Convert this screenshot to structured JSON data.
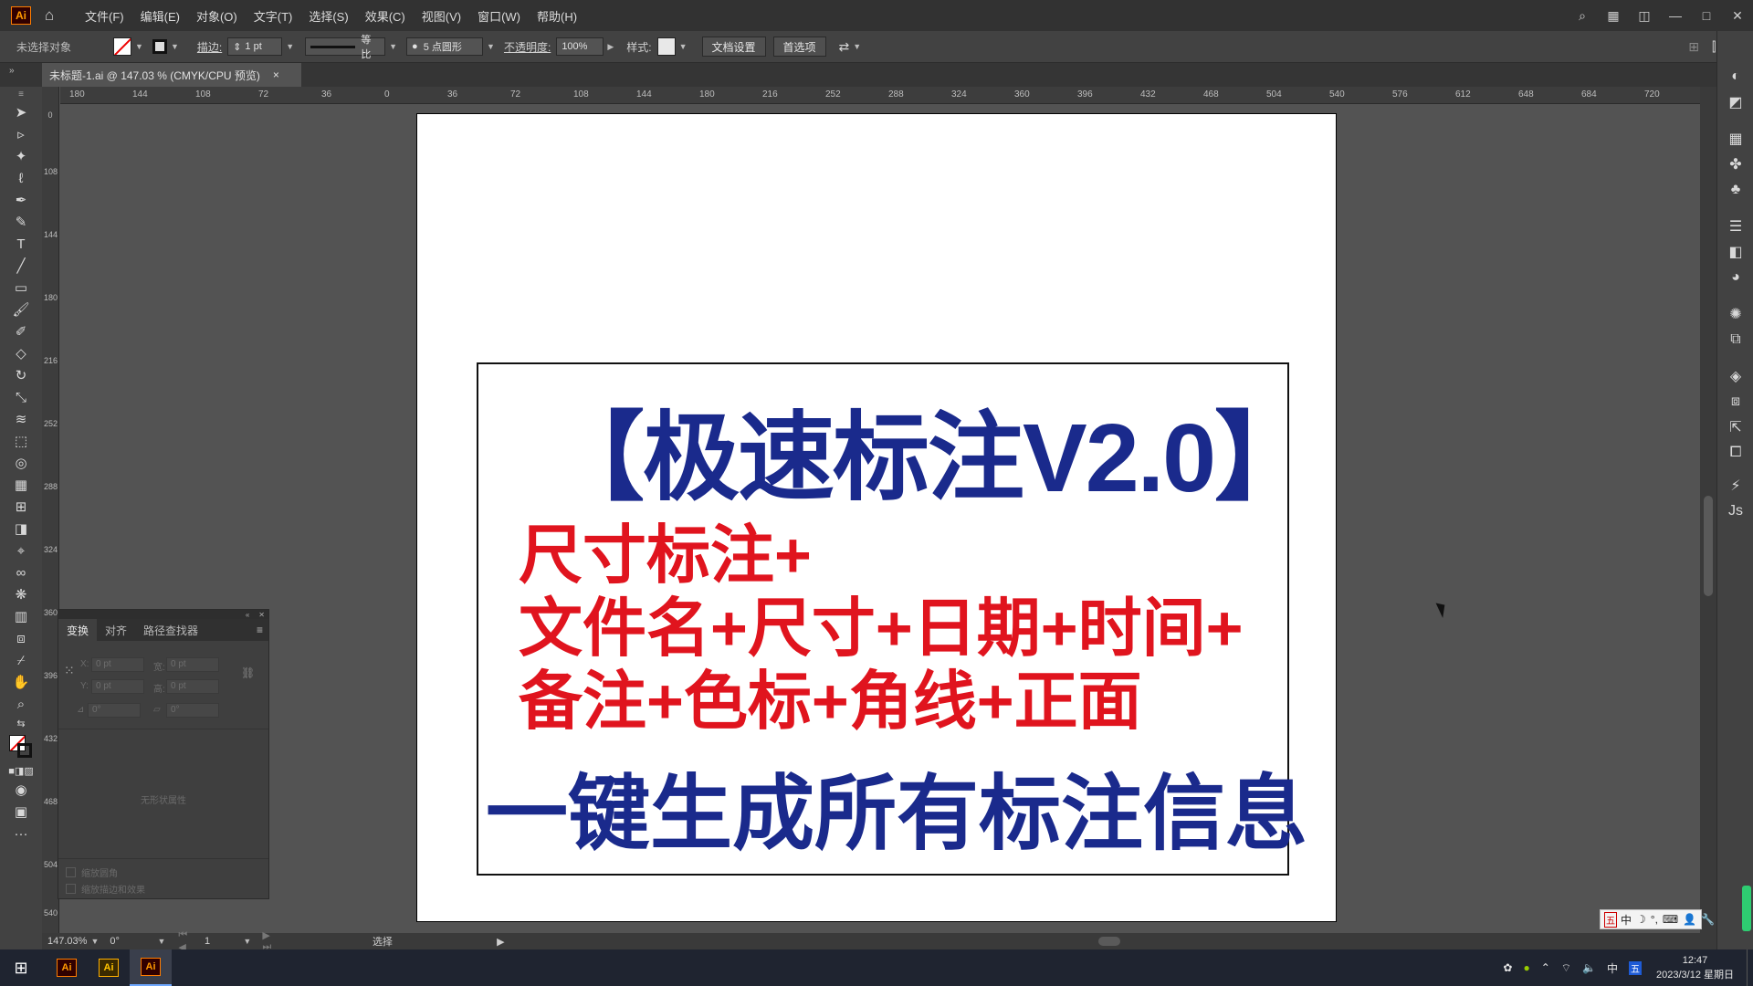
{
  "app": {
    "logo": "Ai",
    "menu": [
      "文件(F)",
      "编辑(E)",
      "对象(O)",
      "文字(T)",
      "选择(S)",
      "效果(C)",
      "视图(V)",
      "窗口(W)",
      "帮助(H)"
    ]
  },
  "control_bar": {
    "selection_status": "未选择对象",
    "stroke_label": "描边:",
    "stroke_value": "1 pt",
    "profile_label": "等比",
    "brush_label": "5 点圆形",
    "opacity_label": "不透明度:",
    "opacity_value": "100%",
    "style_label": "样式:",
    "doc_setup_button": "文档设置",
    "preferences_button": "首选项"
  },
  "document_tab": {
    "title": "未标题-1.ai @ 147.03 % (CMYK/CPU 预览)",
    "close": "×"
  },
  "ruler": {
    "h_ticks": [
      "180",
      "144",
      "108",
      "72",
      "36",
      "0",
      "36",
      "72",
      "108",
      "144",
      "180",
      "216",
      "252",
      "288",
      "324",
      "360",
      "396",
      "432",
      "468",
      "504",
      "540",
      "576",
      "612",
      "648",
      "684",
      "720"
    ],
    "v_ticks": [
      "0",
      "108",
      "144",
      "180",
      "216",
      "252",
      "288",
      "324",
      "360",
      "396",
      "432",
      "468",
      "504",
      "540"
    ]
  },
  "artboard": {
    "title": "【极速标注V2.0】",
    "lines": [
      "尺寸标注+",
      "文件名+尺寸+日期+时间+",
      "备注+色标+角线+正面"
    ],
    "subtitle": "一键生成所有标注信息"
  },
  "panel": {
    "tabs": [
      "变换",
      "对齐",
      "路径查找器"
    ],
    "x_label": "X:",
    "x_value": "0 pt",
    "y_label": "Y:",
    "y_value": "0 pt",
    "w_label": "宽:",
    "w_value": "0 pt",
    "h_label": "高:",
    "h_value": "0 pt",
    "angle_value": "0°",
    "shear_value": "0°",
    "empty_msg": "无形状属性",
    "opt1": "缩放圆角",
    "opt2": "缩放描边和效果"
  },
  "status_bar": {
    "zoom": "147.03%",
    "rotate": "0°",
    "page": "1",
    "tool": "选择"
  },
  "taskbar": {
    "time": "12:47",
    "date": "2023/3/12 星期日",
    "lang": "中",
    "ime_badge": "五"
  },
  "ime_bar": [
    "五",
    "中",
    "☽",
    "°,",
    "⌨",
    "👤",
    "🔧"
  ],
  "colors": {
    "title_blue": "#1a2a8c",
    "accent_red": "#e0141e",
    "app_dark": "#323232",
    "canvas": "#535353"
  }
}
